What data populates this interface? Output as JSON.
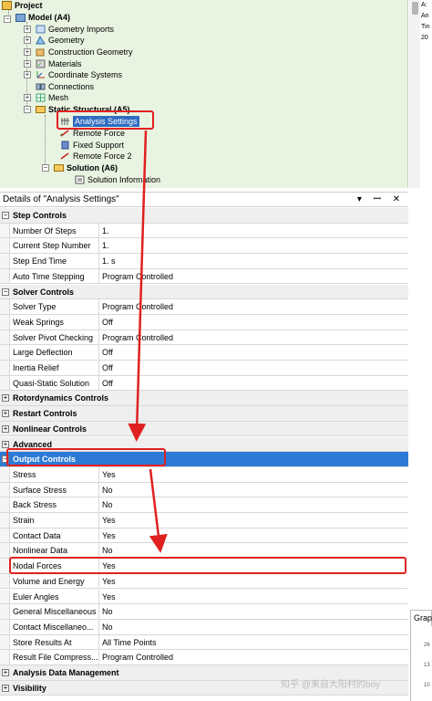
{
  "tree": {
    "project": "Project",
    "model": "Model (A4)",
    "geometry_imports": "Geometry Imports",
    "geometry": "Geometry",
    "construction_geometry": "Construction Geometry",
    "materials": "Materials",
    "coordinate_systems": "Coordinate Systems",
    "connections": "Connections",
    "mesh": "Mesh",
    "static_structural": "Static Structural (A5)",
    "analysis_settings": "Analysis Settings",
    "remote_force": "Remote Force",
    "fixed_support": "Fixed Support",
    "remote_force_2": "Remote Force 2",
    "solution": "Solution (A6)",
    "solution_information": "Solution Information"
  },
  "side_panel": {
    "lines": [
      "A:",
      "An",
      "Tin",
      "20"
    ]
  },
  "details": {
    "title": "Details of \"Analysis Settings\"",
    "controls": "▾ ꟷ ✕",
    "rows": [
      {
        "type": "group",
        "expand": "-",
        "label": "Step Controls"
      },
      {
        "type": "prop",
        "name": "Number Of Steps",
        "value": "1."
      },
      {
        "type": "prop",
        "name": "Current Step Number",
        "value": "1."
      },
      {
        "type": "prop",
        "name": "Step End Time",
        "value": "1. s"
      },
      {
        "type": "prop",
        "name": "Auto Time Stepping",
        "value": "Program Controlled"
      },
      {
        "type": "group",
        "expand": "-",
        "label": "Solver Controls"
      },
      {
        "type": "prop",
        "name": "Solver Type",
        "value": "Program Controlled"
      },
      {
        "type": "prop",
        "name": "Weak Springs",
        "value": "Off"
      },
      {
        "type": "prop",
        "name": "Solver Pivot Checking",
        "value": "Program Controlled"
      },
      {
        "type": "prop",
        "name": "Large Deflection",
        "value": "Off"
      },
      {
        "type": "prop",
        "name": "Inertia Relief",
        "value": "Off"
      },
      {
        "type": "prop",
        "name": "Quasi-Static Solution",
        "value": "Off"
      },
      {
        "type": "group",
        "expand": "+",
        "label": "Rotordynamics Controls"
      },
      {
        "type": "group",
        "expand": "+",
        "label": "Restart Controls"
      },
      {
        "type": "group",
        "expand": "+",
        "label": "Nonlinear Controls"
      },
      {
        "type": "group",
        "expand": "+",
        "label": "Advanced"
      },
      {
        "type": "group",
        "expand": "-",
        "label": "Output Controls",
        "selected": true
      },
      {
        "type": "prop",
        "name": "Stress",
        "value": "Yes"
      },
      {
        "type": "prop",
        "name": "Surface Stress",
        "value": "No"
      },
      {
        "type": "prop",
        "name": "Back Stress",
        "value": "No"
      },
      {
        "type": "prop",
        "name": "Strain",
        "value": "Yes"
      },
      {
        "type": "prop",
        "name": "Contact Data",
        "value": "Yes"
      },
      {
        "type": "prop",
        "name": "Nonlinear Data",
        "value": "No"
      },
      {
        "type": "prop",
        "name": "Nodal Forces",
        "value": "Yes"
      },
      {
        "type": "prop",
        "name": "Volume and Energy",
        "value": "Yes"
      },
      {
        "type": "prop",
        "name": "Euler Angles",
        "value": "Yes"
      },
      {
        "type": "prop",
        "name": "General Miscellaneous",
        "value": "No"
      },
      {
        "type": "prop",
        "name": "Contact Miscellaneo...",
        "value": "No"
      },
      {
        "type": "prop",
        "name": "Store Results At",
        "value": "All Time Points"
      },
      {
        "type": "prop",
        "name": "Result File Compress...",
        "value": "Program Controlled"
      },
      {
        "type": "group",
        "expand": "+",
        "label": "Analysis Data Management"
      },
      {
        "type": "group",
        "expand": "+",
        "label": "Visibility"
      }
    ]
  },
  "graph_tab": "Grap",
  "graph_ticks": [
    "26",
    "13",
    "10"
  ],
  "watermark": "知乎 @来自大阳村的boy",
  "colors": {
    "tree_bg": "#e9f3e1",
    "selection": "#2d7ad6",
    "annotation": "#e02020",
    "check": "#1f9d1f"
  }
}
